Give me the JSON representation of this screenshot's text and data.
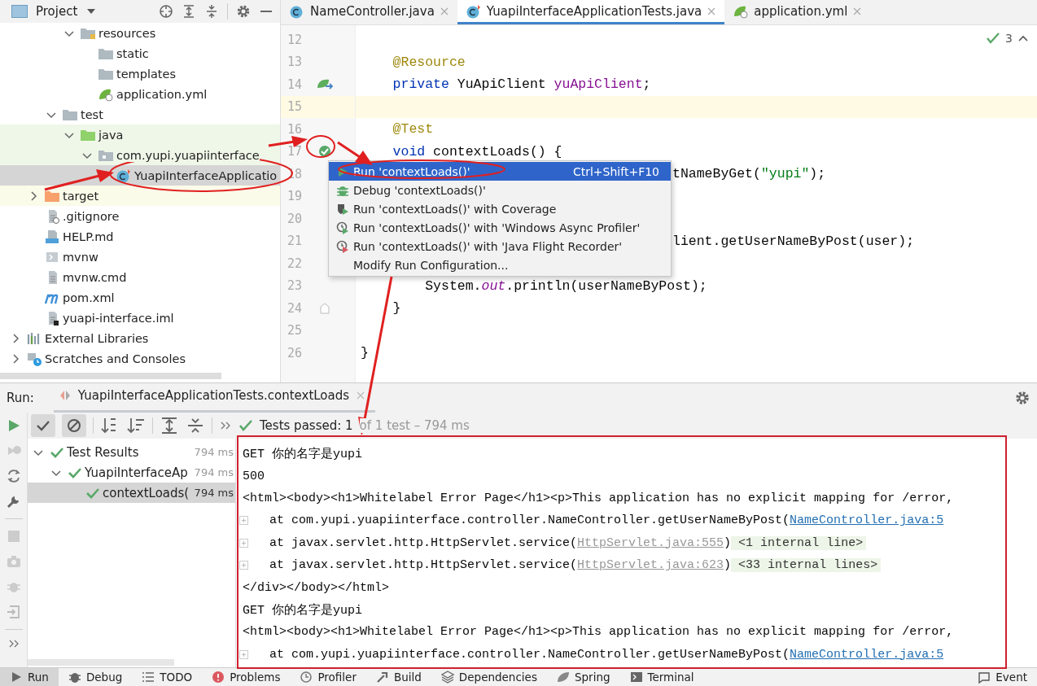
{
  "project_panel": {
    "title": "Project"
  },
  "project_tree": [
    {
      "children": [
        {
          "children": [
            {
              "children": [
                {
                  "label": "resources",
                  "kind": "resource-folder",
                  "expanded": true,
                  "selected": false,
                  "children": [
                    {
                      "label": "static",
                      "kind": "folder",
                      "selected": false
                    },
                    {
                      "label": "templates",
                      "kind": "folder",
                      "selected": false
                    },
                    {
                      "label": "application.yml",
                      "kind": "yaml",
                      "selected": false
                    }
                  ]
                }
              ]
            },
            {
              "label": "test",
              "kind": "folder",
              "expanded": true,
              "selected": false,
              "children": [
                {
                  "label": "java",
                  "kind": "test-folder",
                  "expanded": true,
                  "selected": false,
                  "children": [
                    {
                      "label": "com.yupi.yuapiinterface",
                      "kind": "package",
                      "expanded": true,
                      "selected": false,
                      "children": [
                        {
                          "label": "YuapiInterfaceApplicatio",
                          "kind": "test-class",
                          "selected": true
                        }
                      ]
                    }
                  ]
                }
              ]
            }
          ]
        },
        {
          "label": "target",
          "kind": "excluded-folder",
          "expanded": false,
          "selected": false
        },
        {
          "label": ".gitignore",
          "kind": "ignore-file",
          "selected": false
        },
        {
          "label": "HELP.md",
          "kind": "markdown",
          "selected": false
        },
        {
          "label": "mvnw",
          "kind": "script",
          "selected": false
        },
        {
          "label": "mvnw.cmd",
          "kind": "text",
          "selected": false
        },
        {
          "label": "pom.xml",
          "kind": "maven",
          "selected": false
        },
        {
          "label": "yuapi-interface.iml",
          "kind": "module",
          "selected": false
        }
      ]
    },
    {
      "label": "External Libraries",
      "kind": "libraries",
      "expanded": false,
      "selected": false
    },
    {
      "label": "Scratches and Consoles",
      "kind": "scratches",
      "expanded": false,
      "selected": false
    }
  ],
  "editor_tabs": [
    {
      "label": "NameController.java",
      "kind": "class",
      "selected": false
    },
    {
      "label": "YuapiInterfaceApplicationTests.java",
      "kind": "test-class",
      "selected": true
    },
    {
      "label": "application.yml",
      "kind": "yaml",
      "selected": false
    }
  ],
  "inspection_count": "3",
  "code_lines": [
    {
      "number": "12"
    },
    {
      "number": "13",
      "kind": "member",
      "tokens": [
        {
          "text": "@Resource",
          "kind": "annotation"
        }
      ]
    },
    {
      "number": "14",
      "kind": "member",
      "gutter": {
        "kind": "bean"
      },
      "tokens": [
        {
          "text": "private",
          "kind": "keyword"
        },
        {
          "text": "YuApiClient",
          "kind": "plain",
          "spaced": true
        },
        {
          "text": "yuApiClient",
          "kind": "field",
          "spaced": true
        },
        {
          "text": ";",
          "kind": "plain"
        }
      ]
    },
    {
      "number": "15",
      "current": true
    },
    {
      "number": "16",
      "kind": "member",
      "tokens": [
        {
          "text": "@Test",
          "kind": "annotation"
        }
      ]
    },
    {
      "number": "17",
      "kind": "member",
      "gutter": {
        "kind": "run"
      },
      "tokens": [
        {
          "text": "void",
          "kind": "keyword"
        },
        {
          "text": "contextLoads() {",
          "kind": "plain",
          "spaced": true
        }
      ]
    },
    {
      "number": "18",
      "after_menu": true,
      "tokens": [
        {
          "text": "tNameByGet(",
          "kind": "plain"
        },
        {
          "text": "\"yupi\"",
          "kind": "string"
        },
        {
          "text": ");",
          "kind": "plain"
        }
      ]
    },
    {
      "number": "19"
    },
    {
      "number": "20"
    },
    {
      "number": "21",
      "after_menu": true,
      "tokens": [
        {
          "text": "lient.getUserNameByPost(user);",
          "kind": "plain"
        }
      ]
    },
    {
      "number": "22"
    },
    {
      "number": "23",
      "kind": "body",
      "tokens": [
        {
          "text": "System.",
          "kind": "plain"
        },
        {
          "text": "out",
          "kind": "static"
        },
        {
          "text": ".println(userNameByPost);",
          "kind": "plain"
        }
      ]
    },
    {
      "number": "24",
      "kind": "member",
      "gutter": {
        "kind": "fold"
      },
      "tokens": [
        {
          "text": "}",
          "kind": "plain"
        }
      ]
    },
    {
      "number": "25"
    },
    {
      "number": "26",
      "tokens": [
        {
          "text": "}",
          "kind": "plain"
        }
      ]
    }
  ],
  "context_menu": [
    {
      "label": "Run 'contextLoads()'",
      "kind": "run",
      "shortcut": "Ctrl+Shift+F10",
      "selected": true
    },
    {
      "label": "Debug 'contextLoads()'",
      "kind": "debug",
      "selected": false
    },
    {
      "label": "Run 'contextLoads()' with Coverage",
      "kind": "coverage",
      "selected": false
    },
    {
      "label": "Run 'contextLoads()' with 'Windows Async Profiler'",
      "kind": "profiler",
      "selected": false
    },
    {
      "label": "Run 'contextLoads()' with 'Java Flight Recorder'",
      "kind": "recorder",
      "selected": false
    },
    {
      "label": "Modify Run Configuration...",
      "kind": "plain",
      "selected": false
    }
  ],
  "run_panel": {
    "title": "Run:",
    "tab": "YuapiInterfaceApplicationTests.contextLoads",
    "show_passed": true,
    "show_ignored": true,
    "status": "Tests passed: 1",
    "status_detail": "of 1 test – 794 ms"
  },
  "test_tree": [
    {
      "label": "Test Results",
      "time": "794 ms",
      "expanded": true,
      "selected": false,
      "children": [
        {
          "label": "YuapiInterfaceAp",
          "time": "794 ms",
          "expanded": true,
          "selected": false,
          "children": [
            {
              "label": "contextLoads(",
              "time": "794 ms",
              "selected": true
            }
          ]
        }
      ]
    }
  ],
  "console_lines": [
    {
      "kind": "plain",
      "text": "GET 你的名字是yupi"
    },
    {
      "kind": "plain",
      "text": "500"
    },
    {
      "kind": "plain",
      "text": "<html><body><h1>Whitelabel Error Page</h1><p>This application has no explicit mapping for /error,"
    },
    {
      "kind": "trace",
      "text": "at com.yupi.yuapiinterface.controller.NameController.getUserNameByPost(",
      "link": {
        "text": "NameController.java:5",
        "kind": "source"
      }
    },
    {
      "kind": "trace",
      "text": "at javax.servlet.http.HttpServlet.service(",
      "link": {
        "text": "HttpServlet.java:555",
        "kind": "library"
      },
      "after": ")",
      "folded": "<1 internal line>"
    },
    {
      "kind": "trace",
      "text": "at javax.servlet.http.HttpServlet.service(",
      "link": {
        "text": "HttpServlet.java:623",
        "kind": "library"
      },
      "after": ")",
      "folded": "<33 internal lines>"
    },
    {
      "kind": "plain",
      "text": "</div></body></html>"
    },
    {
      "kind": "plain",
      "text": "GET 你的名字是yupi"
    },
    {
      "kind": "plain",
      "text": "<html><body><h1>Whitelabel Error Page</h1><p>This application has no explicit mapping for /error,"
    },
    {
      "kind": "trace",
      "text": "at com.yupi.yuapiinterface.controller.NameController.getUserNameByPost(",
      "link": {
        "text": "NameController.java:5",
        "kind": "source"
      }
    }
  ],
  "tool_windows": [
    {
      "label": "Run",
      "kind": "run",
      "selected": true
    },
    {
      "label": "Debug",
      "kind": "debug",
      "selected": false
    },
    {
      "label": "TODO",
      "kind": "todo",
      "selected": false
    },
    {
      "label": "Problems",
      "kind": "problems",
      "selected": false
    },
    {
      "label": "Profiler",
      "kind": "profiler",
      "selected": false
    },
    {
      "label": "Build",
      "kind": "build",
      "selected": false
    },
    {
      "label": "Dependencies",
      "kind": "dependencies",
      "selected": false
    },
    {
      "label": "Spring",
      "kind": "spring",
      "selected": false
    },
    {
      "label": "Terminal",
      "kind": "terminal",
      "selected": false
    }
  ],
  "event_log": "Event"
}
